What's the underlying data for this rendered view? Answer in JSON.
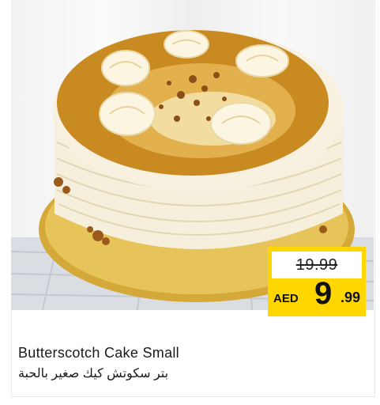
{
  "product": {
    "name_en": "Butterscotch Cake Small",
    "name_ar": "بتر سكوتش كيك صغير بالحبة",
    "image_icon": "butterscotch-cake-photo"
  },
  "price": {
    "old": "19.99",
    "currency": "AED",
    "new_int": "9",
    "new_dec": ".99"
  },
  "colors": {
    "tag_yellow": "#ffd600",
    "caramel": "#c98a22"
  }
}
